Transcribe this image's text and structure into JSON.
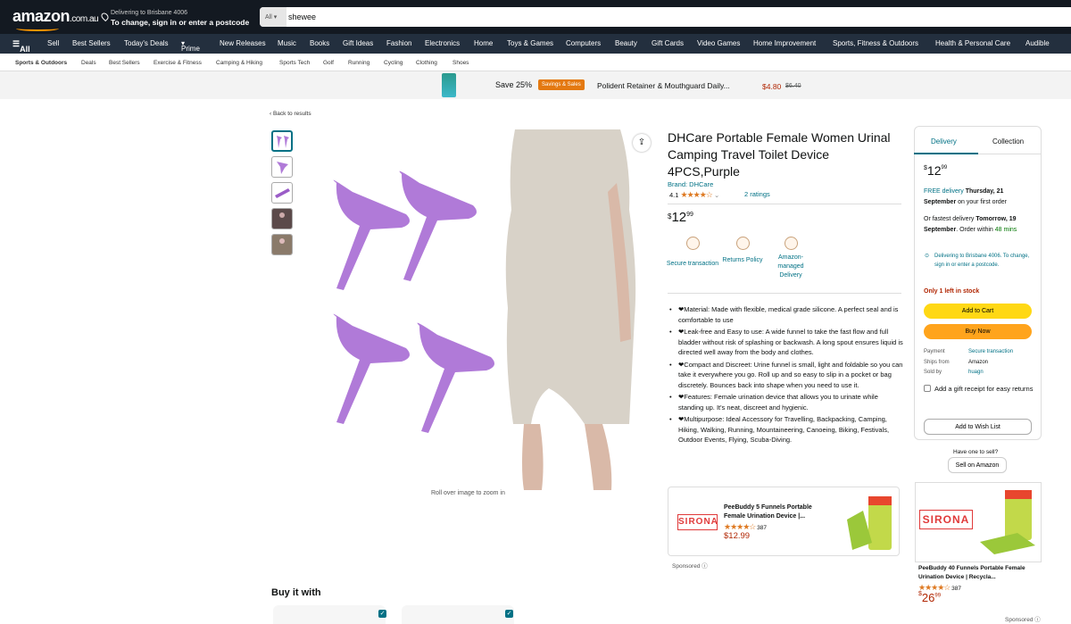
{
  "header": {
    "logo": "amazon",
    "logo_tld": ".com.au",
    "delivering_line": "Delivering to Brisbane 4006",
    "change_line": "To change, sign in or enter a postcode",
    "search_category": "All",
    "search_value": "shewee"
  },
  "nav": {
    "all": "All",
    "items": [
      "Sell",
      "Best Sellers",
      "Today's Deals",
      "Prime",
      "New Releases",
      "Music",
      "Books",
      "Gift Ideas",
      "Fashion",
      "Electronics",
      "Home",
      "Toys & Games",
      "Computers",
      "Beauty",
      "Gift Cards",
      "Video Games",
      "Home Improvement",
      "Sports, Fitness & Outdoors",
      "Health & Personal Care",
      "Audible"
    ]
  },
  "subnav": {
    "items": [
      "Sports & Outdoors",
      "Deals",
      "Best Sellers",
      "Exercise & Fitness",
      "Camping & Hiking",
      "Sports Tech",
      "Golf",
      "Running",
      "Cycling",
      "Clothing",
      "Shoes"
    ]
  },
  "promo": {
    "save": "Save 25%",
    "badge": "Savings & Sales",
    "product": "Polident Retainer & Mouthguard Daily...",
    "price": "$4.80",
    "old_price": "$6.40"
  },
  "back_link": "‹ Back to results",
  "rollover": "Roll over image to zoom in",
  "product": {
    "title": "DHCare Portable Female Women Urinal Camping Travel Toilet Device 4PCS,Purple",
    "brand": "Brand: DHCare",
    "rating_value": "4.1",
    "stars": "★★★★☆",
    "ratings_count": "2 ratings",
    "price_currency": "$",
    "price_whole": "12",
    "price_fraction": "99",
    "features": [
      {
        "label": "Secure transaction",
        "icon": "lock-icon"
      },
      {
        "label": "Returns Policy",
        "icon": "returns-box-icon"
      },
      {
        "label": "Amazon-managed Delivery",
        "icon": "delivery-truck-icon"
      }
    ],
    "bullets": [
      "❤Material: Made with flexible, medical grade silicone. A perfect seal and is comfortable to use",
      "❤Leak-free and Easy to use: A wide funnel to take the fast flow and full bladder without risk of splashing or backwash. A long spout ensures liquid is directed well away from the body and clothes.",
      "❤Compact and Discreet: Urine funnel is small, light and foldable so you can take it everywhere you go. Roll up and so easy to slip in a pocket or bag discretely. Bounces back into shape when you need to use it.",
      "❤Features: Female urination device that allows you to urinate while standing up. It's neat, discreet and hygienic.",
      "❤Multipurpose: Ideal Accessory for Travelling, Backpacking, Camping, Hiking, Walking, Running, Mountaineering, Canoeing, Biking, Festivals, Outdoor Events, Flying, Scuba-Diving."
    ]
  },
  "ad1": {
    "brand": "SIRONA",
    "title": "PeeBuddy 5 Funnels Portable Female Urination Device |...",
    "stars": "★★★★☆",
    "count": "387",
    "price": "$12.99",
    "sponsored": "Sponsored"
  },
  "buybox": {
    "tab_delivery": "Delivery",
    "tab_collection": "Collection",
    "price_currency": "$",
    "price_whole": "12",
    "price_fraction": "99",
    "free_delivery": "FREE delivery",
    "free_date": "Thursday, 21 September",
    "first_order": "on your first order",
    "fastest_prefix": "Or fastest delivery",
    "fastest_date": "Tomorrow, 19 September",
    "order_within": "Order within",
    "order_time": "48 mins",
    "deliver_to": "Delivering to Brisbane 4006. To change, sign in or enter a postcode.",
    "stock": "Only 1 left in stock",
    "add_to_cart": "Add to Cart",
    "buy_now": "Buy Now",
    "payment_k": "Payment",
    "payment_v": "Secure transaction",
    "ships_k": "Ships from",
    "ships_v": "Amazon",
    "sold_k": "Sold by",
    "sold_v": "huagn",
    "gift": "Add a gift receipt for easy returns",
    "wishlist": "Add to Wish List",
    "have_one": "Have one to sell?",
    "sell_on": "Sell on Amazon"
  },
  "ad2": {
    "brand": "SIRONA",
    "title": "PeeBuddy 40 Funnels Portable Female Urination Device | Recycla...",
    "stars": "★★★★☆",
    "count": "387",
    "price_currency": "$",
    "price_whole": "26",
    "price_fraction": "99",
    "sponsored": "Sponsored"
  },
  "buy_it_with": "Buy it with",
  "colors": {
    "purple": "#b07ad8",
    "teal": "#007185",
    "cart": "#ffd814",
    "buy": "#ffa41c"
  }
}
